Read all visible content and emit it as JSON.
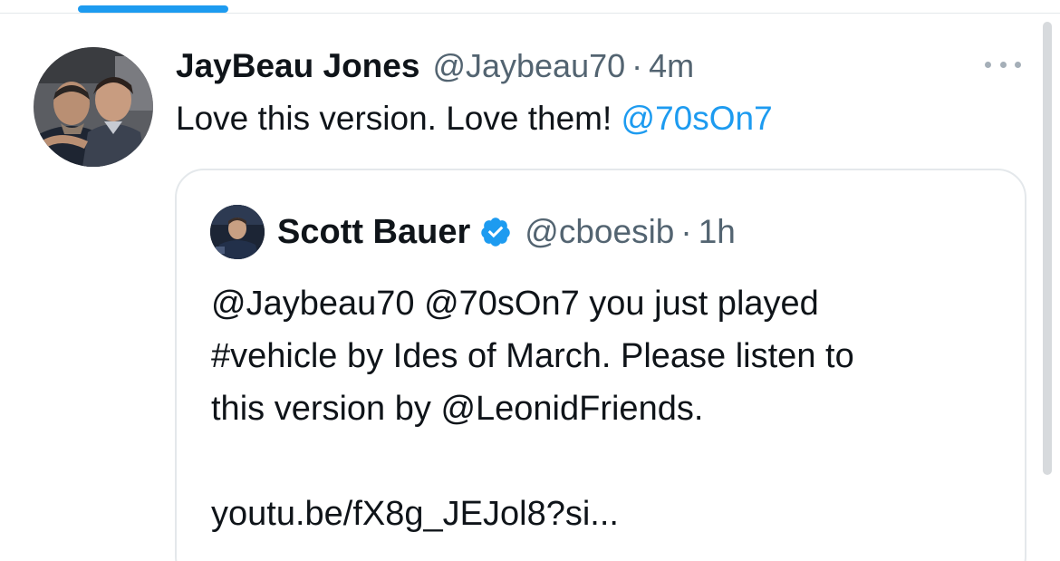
{
  "tweet": {
    "display_name": "JayBeau Jones",
    "handle": "@Jaybeau70",
    "separator": "·",
    "time": "4m",
    "text": "Love this version. Love them!",
    "mention": "@70sOn7",
    "more_icon": "more-horizontal-icon"
  },
  "quoted_tweet": {
    "display_name": "Scott Bauer",
    "verified_icon": "verified-badge-icon",
    "handle": "@cboesib",
    "separator": "·",
    "time": "1h",
    "lines": [
      "@Jaybeau70 @70sOn7 you just played",
      "#vehicle by Ides of March.  Please listen to",
      "this version by @LeonidFriends.",
      "",
      "youtu.be/fX8g_JEJol8?si..."
    ]
  },
  "colors": {
    "accent": "#1d9bf0",
    "secondary_text": "#536471",
    "primary_text": "#0f1419",
    "border": "#e4e8eb"
  }
}
